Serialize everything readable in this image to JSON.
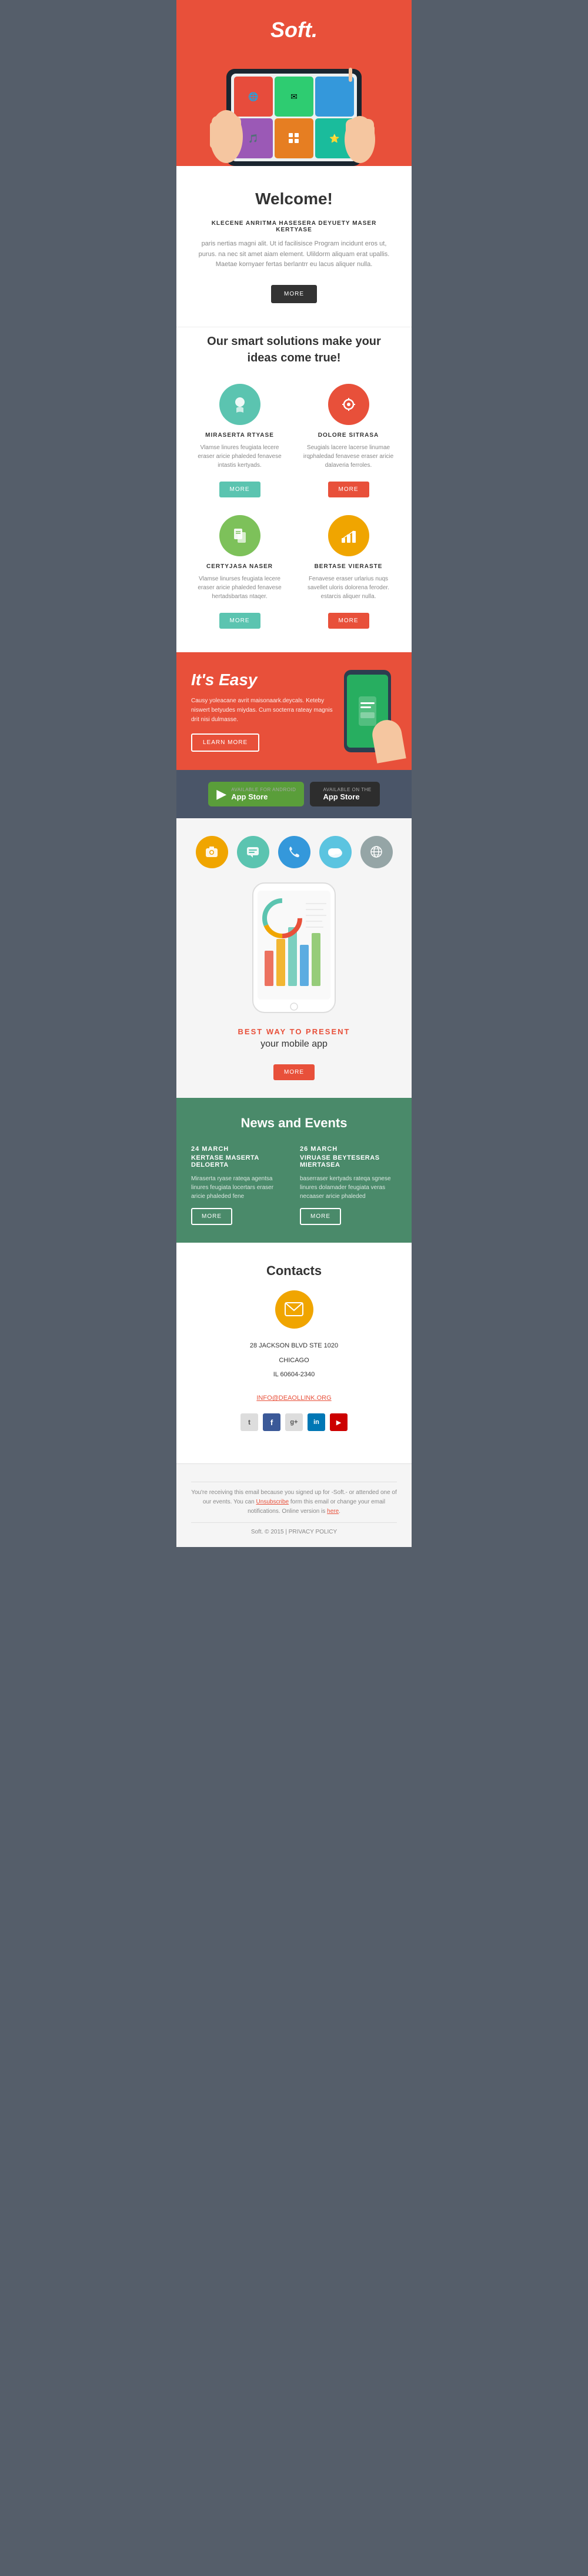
{
  "hero": {
    "title": "Soft."
  },
  "welcome": {
    "title": "Welcome!",
    "subtitle": "KLECENE ANRITMA HASESERA DEYUETY MASER KERTYASE",
    "body": "paris nertias magni alit. Ut id facilisisce Program incidunt eros ut, purus. na nec sit amet aiam element. Ulildorm aliquam erat upallis. Maetae kornyaer fertas berlantrr eu lacus aliquer nulla.",
    "btn_more": "MORE"
  },
  "solutions": {
    "title": "Our smart solutions make your ideas come true!",
    "items": [
      {
        "name": "MIRASERTA RTYASE",
        "desc": "Vlamse linures feugiata lecere eraser aricie phaleded fenavese intastis kertyads.",
        "btn": "MORE",
        "icon": "💡",
        "color": "teal"
      },
      {
        "name": "DOLORE SITRASA",
        "desc": "Seugials lacere lacerse linumae irqphaledad fenavese eraser aricie dalaveria ferroles.",
        "btn": "MORE",
        "icon": "⚙️",
        "color": "red"
      },
      {
        "name": "CERTYJASA NASER",
        "desc": "Vlamse linurses feugiata lecere eraser aricie phaleded fenavese hertadsbartas ntaqer.",
        "btn": "MORE",
        "icon": "📋",
        "color": "green"
      },
      {
        "name": "BERTASE VIERASTE",
        "desc": "Fenavese eraser urlarius nuqs savellet uloris dolorena feroder. estarcis aliquer nulla.",
        "btn": "MORE",
        "icon": "📊",
        "color": "orange"
      }
    ]
  },
  "easy": {
    "title": "It's Easy",
    "body": "Causy yoleacane avrit maisonaark.deycals. Keteby niswert betyudes miydas. Cum socterra rateay magnis drit nisi dulmasse.",
    "btn": "LEARN MORE"
  },
  "appstore": {
    "android_label": "Available for Android",
    "android_name": "App Store",
    "ios_label": "Available on the",
    "ios_name": "App Store"
  },
  "showcase": {
    "label": "BEST WAY TO PRESENT",
    "subtitle": "your mobile app",
    "btn": "MORE"
  },
  "news": {
    "title": "News and Events",
    "items": [
      {
        "date": "24 MARCH",
        "event": "KERTASE MASERTA DELOERTA",
        "desc": "Miraserta ryase rateqa agentsa linures feugiata locertars eraser aricie phaleded fene",
        "btn": "MORE"
      },
      {
        "date": "26 MARCH",
        "event": "VIRUASE BEYTESERAS MIERTASEA",
        "desc": "baserraser kertyads rateqa sgnese linures dolamader feugiata veras necaaser aricie phaleded",
        "btn": "MORE"
      }
    ]
  },
  "contacts": {
    "title": "Contacts",
    "address_line1": "28 JACKSON BLVD STE 1020",
    "address_line2": "CHICAGO",
    "address_line3": "IL 60604-2340",
    "email": "INFO@DEAOLLINK.ORG",
    "social_icons": [
      "𝕏",
      "f",
      "g+",
      "in",
      "▶"
    ]
  },
  "footer": {
    "text": "You're receiving this email because you signed up for -Soft.- or attended one of our events. You can",
    "unsubscribe": "Unsubscribe",
    "text2": "form this email or change your email notifications. Online version is",
    "here": "here",
    "bottom": "Soft. © 2015  |  PRIVACY POLICY"
  }
}
